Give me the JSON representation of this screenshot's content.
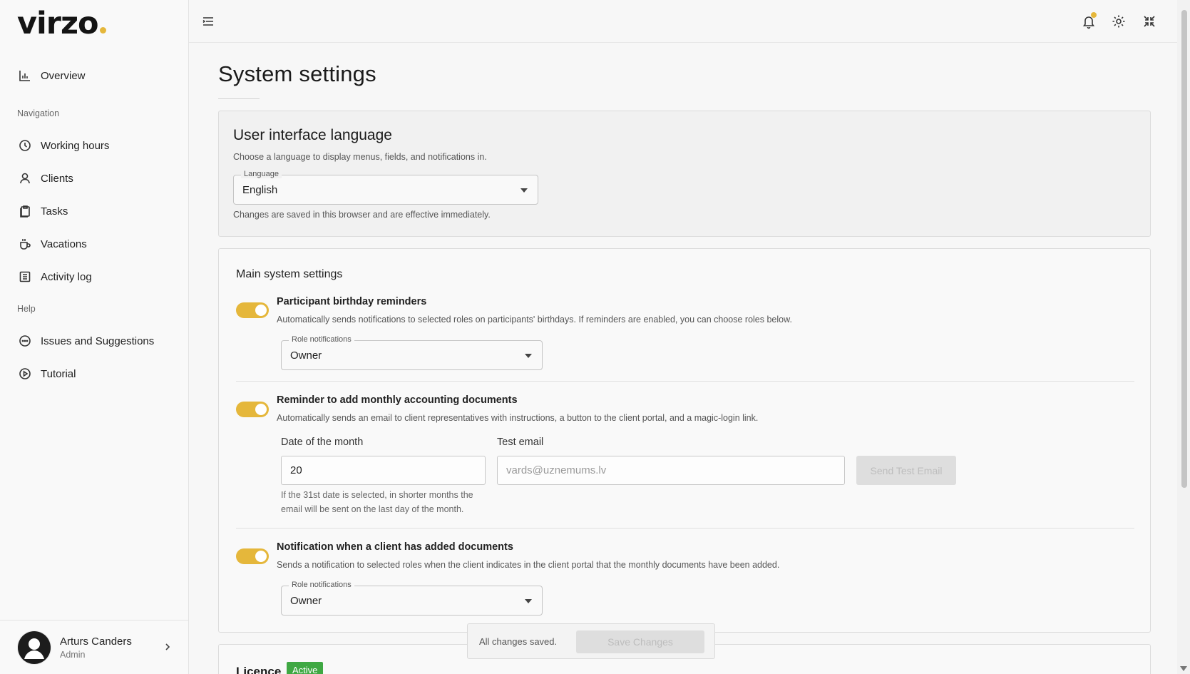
{
  "app": {
    "logo": "virzo"
  },
  "sidebar": {
    "overview": "Overview",
    "section_navigation": "Navigation",
    "items": [
      "Working hours",
      "Clients",
      "Tasks",
      "Vacations",
      "Activity log"
    ],
    "section_help": "Help",
    "help_items": [
      "Issues and Suggestions",
      "Tutorial"
    ],
    "user": {
      "name": "Arturs Canders",
      "role": "Admin"
    }
  },
  "page": {
    "title": "System settings"
  },
  "language_card": {
    "title": "User interface language",
    "description": "Choose a language to display menus, fields, and notifications in.",
    "select_label": "Language",
    "select_value": "English",
    "helper": "Changes are saved in this browser and are effective immediately."
  },
  "main_card": {
    "title": "Main system settings",
    "birthday": {
      "title": "Participant birthday reminders",
      "description": "Automatically sends notifications to selected roles on participants' birthdays. If reminders are enabled, you can choose roles below.",
      "select_label": "Role notifications",
      "select_value": "Owner",
      "enabled": true
    },
    "monthly": {
      "title": "Reminder to add monthly accounting documents",
      "description": "Automatically sends an email to client representatives with instructions, a button to the client portal, and a magic-login link.",
      "date_label": "Date of the month",
      "date_value": "20",
      "email_label": "Test email",
      "email_placeholder": "vards@uznemums.lv",
      "send_button": "Send Test Email",
      "helper": "If the 31st date is selected, in shorter months the email will be sent on the last day of the month.",
      "enabled": true
    },
    "client_docs": {
      "title": "Notification when a client has added documents",
      "description": "Sends a notification to selected roles when the client indicates in the client portal that the monthly documents have been added.",
      "select_label": "Role notifications",
      "select_value": "Owner",
      "enabled": true
    }
  },
  "save_bar": {
    "status": "All changes saved.",
    "button": "Save Changes"
  },
  "licence": {
    "title": "Licence",
    "badge": "Active"
  },
  "colors": {
    "accent": "#e5b73b",
    "badge_green": "#3fa843"
  }
}
